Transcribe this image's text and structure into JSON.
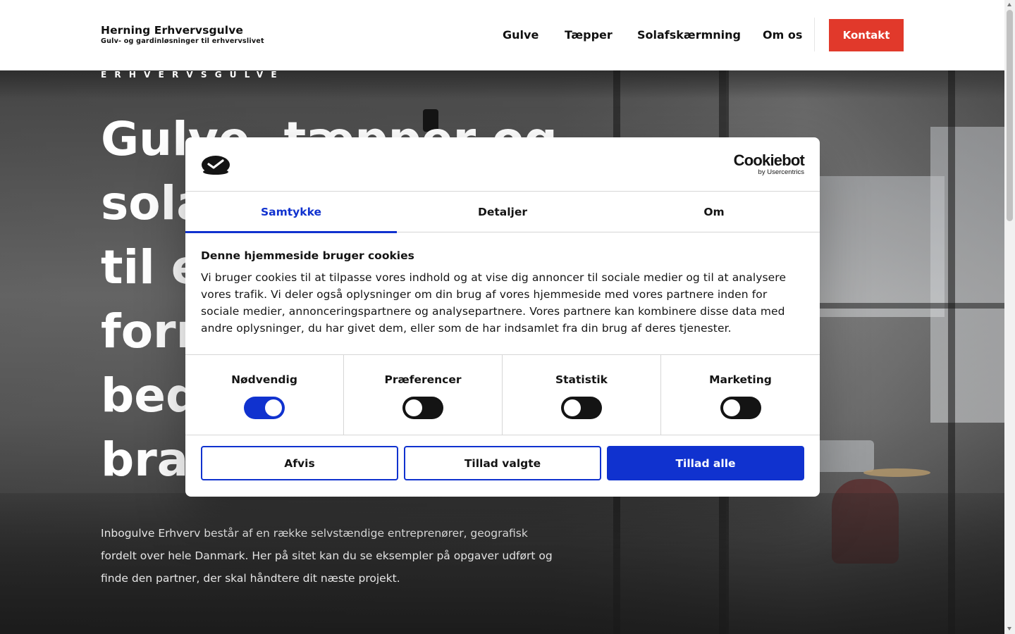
{
  "header": {
    "logo_name": "Herning Erhvervsgulve",
    "logo_tagline": "Gulv- og gardinløsninger til erhvervslivet",
    "nav": [
      "Gulve",
      "Tæpper",
      "Solafskærmning",
      "Om os"
    ],
    "contact_label": "Kontakt",
    "accent_color": "#e1392b"
  },
  "hero": {
    "eyebrow": "ERHVERVSGULVE",
    "headline_lines": [
      "Gulve, tæpper og",
      "sola",
      "til e",
      "forr",
      "bed",
      "bra"
    ],
    "intro": "Inbogulve Erhverv består af en række selvstændige entreprenører, geografisk fordelt over hele Danmark. Her på sitet kan du se eksempler på opgaver udført og finde den partner, der skal håndtere dit næste projekt."
  },
  "cookie_dialog": {
    "brand_name": "Cookiebot",
    "brand_sub": "by Usercentrics",
    "tabs": [
      "Samtykke",
      "Detaljer",
      "Om"
    ],
    "active_tab": "Samtykke",
    "title": "Denne hjemmeside bruger cookies",
    "text": "Vi bruger cookies til at tilpasse vores indhold og at vise dig annoncer til sociale medier og til at analysere vores trafik. Vi deler også oplysninger om din brug af vores hjemmeside med vores partnere inden for sociale medier, annonceringspartnere og analysepartnere. Vores partnere kan kombinere disse data med andre oplysninger, du har givet dem, eller som de har indsamlet fra din brug af deres tjenester.",
    "toggles": [
      {
        "label": "Nødvendig",
        "on": true
      },
      {
        "label": "Præferencer",
        "on": false
      },
      {
        "label": "Statistik",
        "on": false
      },
      {
        "label": "Marketing",
        "on": false
      }
    ],
    "buttons": {
      "reject": "Afvis",
      "allow_selected": "Tillad valgte",
      "allow_all": "Tillad alle"
    },
    "accent_color": "#1032cf"
  }
}
